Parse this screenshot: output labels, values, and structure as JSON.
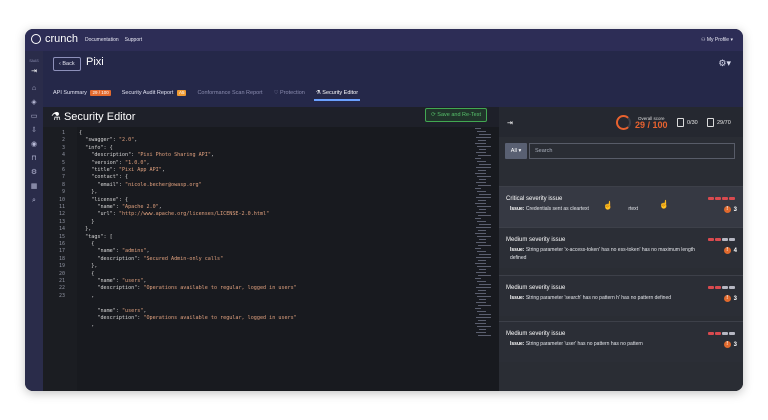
{
  "topbar": {
    "brand": "crunch",
    "nav": [
      "Documentation",
      "Support"
    ],
    "profile": "My Profile"
  },
  "leftrail": {
    "label": "SAAS"
  },
  "header": {
    "back_label": "Back",
    "title": "Pixi",
    "tabs": [
      {
        "label": "API Summary",
        "badge": "29 / 100",
        "badge_color": "#e36a2e"
      },
      {
        "label": "Security Audit Report",
        "badge": "A5",
        "badge_color": "#f09a31"
      },
      {
        "label": "Conformance Scan Report"
      },
      {
        "label": "Protection"
      },
      {
        "label": "Security Editor"
      }
    ]
  },
  "editor": {
    "title": "Security Editor",
    "save_label": "Save and Re-Test",
    "line_numbers": [
      "1",
      "2",
      "3",
      "4",
      "5",
      "6",
      "7",
      "8",
      "9",
      "10",
      "11",
      "12",
      "13",
      "14",
      "15",
      "16",
      "17",
      "18",
      "19",
      "20",
      "21",
      "22",
      "23"
    ],
    "lines": [
      "{",
      "  \"swagger\": \"2.0\",",
      "  \"info\": {",
      "    \"description\": \"Pixi Photo Sharing API\",",
      "    \"version\": \"1.0.0\",",
      "    \"title\": \"Pixi App API\",",
      "    \"contact\": {",
      "      \"email\": \"nicole.becher@owasp.org\"",
      "    },",
      "    \"license\": {",
      "      \"name\": \"Apache 2.0\",",
      "      \"url\": \"http://www.apache.org/licenses/LICENSE-2.0.html\"",
      "    }",
      "  },",
      "  \"tags\": [",
      "    {",
      "      \"name\": \"admins\",",
      "      \"description\": \"Secured Admin-only calls\"",
      "    },",
      "    {",
      "      \"name\": \"users\",",
      "      \"description\": \"Operations available to regular, logged in users\"",
      "    ,",
      "",
      "      \"name\": \"users\",",
      "      \"description\": \"Operations available to regular, logged in users\"",
      "    ,"
    ]
  },
  "panel": {
    "score_label": "Overall score",
    "score_value": "29 / 100",
    "meter1": "0/30",
    "meter2": "29/70",
    "filter_label": "All",
    "search_placeholder": "Search",
    "issues": [
      {
        "title": "Critical severity issue",
        "issue_label": "Issue:",
        "text": "Credentials sent as cleartext",
        "extra": "rtext",
        "count": "3"
      },
      {
        "title": "Medium severity issue",
        "issue_label": "Issue:",
        "text": "String parameter 'x-access-token' has no  ess-token' has no maximum length defined",
        "count": "4"
      },
      {
        "title": "Medium severity issue",
        "issue_label": "Issue:",
        "text": "String parameter 'search' has no pattern  h' has no pattern defined",
        "count": "3"
      },
      {
        "title": "Medium severity issue",
        "issue_label": "Issue:",
        "text": "String parameter 'user' has no pattern     has no pattern",
        "count": "3"
      }
    ]
  },
  "colors": {
    "accent": "#6ba1ff",
    "critical": "#d94a4f",
    "score": "#e8622f",
    "success": "#57c26b"
  }
}
